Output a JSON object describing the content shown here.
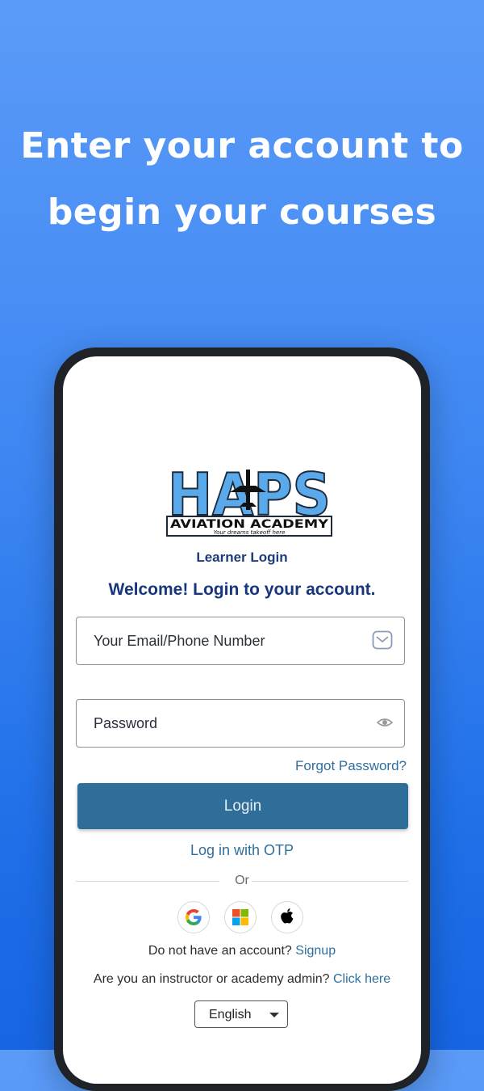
{
  "headline": {
    "line1": "Enter your account to",
    "line2": "begin your courses"
  },
  "logo": {
    "brand_text": "HAPS",
    "academy_text": "AVIATION ACADEMY",
    "tagline": "Your dreams takeoff here"
  },
  "login": {
    "title": "Learner Login",
    "welcome": "Welcome! Login to your account.",
    "email_placeholder": "Your Email/Phone Number",
    "password_placeholder": "Password",
    "forgot_label": "Forgot Password?",
    "login_button": "Login",
    "otp_label": "Log in with OTP",
    "or_label": "Or",
    "signup_prompt": "Do not have an account?",
    "signup_link": "Signup",
    "admin_prompt": "Are you an instructor or academy admin?",
    "admin_link": "Click here",
    "language": "English"
  },
  "social": [
    "google-icon",
    "microsoft-icon",
    "apple-icon"
  ],
  "colors": {
    "background_top": "#5b9bf8",
    "background_bottom": "#1665e3",
    "primary_button": "#2e6e98",
    "link": "#2f6f9f",
    "heading": "#17367c"
  }
}
